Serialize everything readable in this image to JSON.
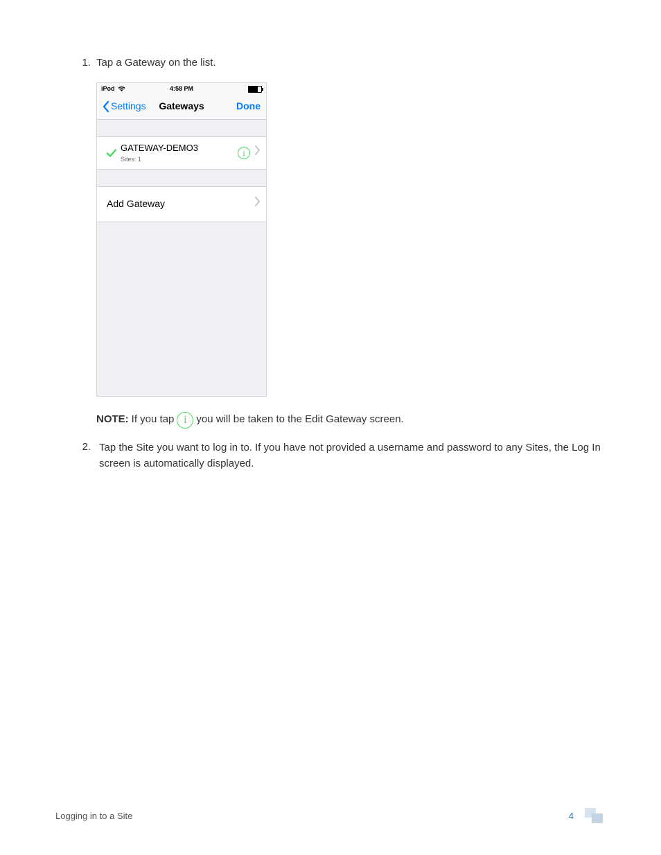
{
  "steps": {
    "one": "Tap a Gateway on the list.",
    "two": "Tap the Site you want to log in to. If you have not provided a username and password to any Sites, the Log In screen is automatically displayed."
  },
  "phone": {
    "status": {
      "device": "iPod",
      "time": "4:58 PM"
    },
    "nav": {
      "back": "Settings",
      "title": "Gateways",
      "done": "Done"
    },
    "gateway": {
      "name": "GATEWAY-DEMO3",
      "subtitle": "Sites: 1"
    },
    "add_gateway": "Add Gateway"
  },
  "note": {
    "label": "NOTE:",
    "before": "If you tap",
    "after": "you will be taken to the Edit Gateway screen."
  },
  "step2_marker": "2.",
  "footer": {
    "title": "Logging in to a Site",
    "page": "4"
  }
}
